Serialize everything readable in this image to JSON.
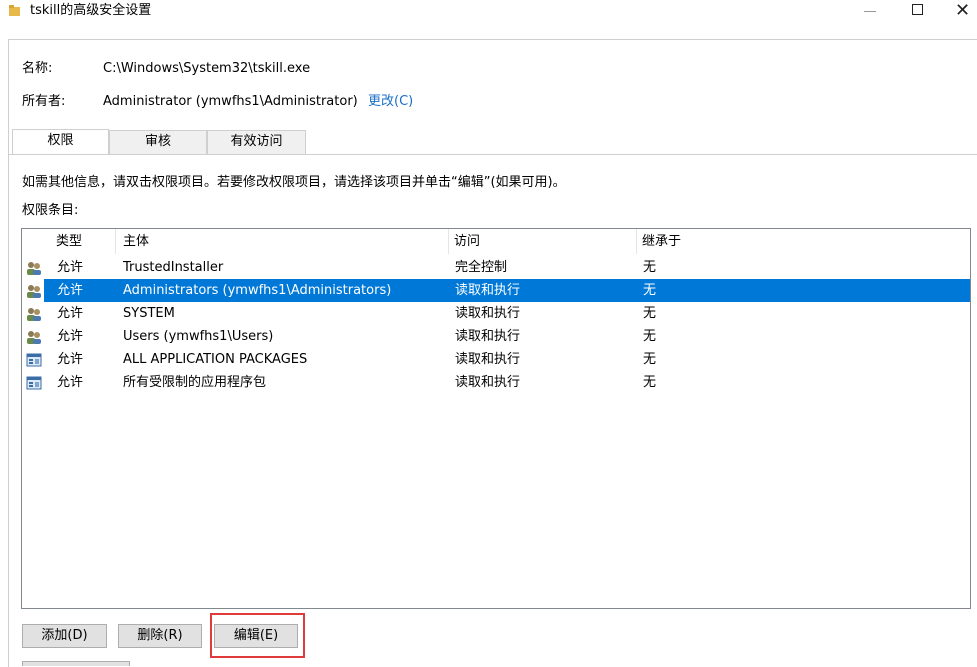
{
  "window": {
    "title": "tskill的高级安全设置"
  },
  "info": {
    "name_label": "名称:",
    "name_value": "C:\\Windows\\System32\\tskill.exe",
    "owner_label": "所有者:",
    "owner_value": "Administrator (ymwfhs1\\Administrator)",
    "change_link": "更改(C)"
  },
  "tabs": [
    {
      "label": "权限",
      "active": true
    },
    {
      "label": "审核",
      "active": false
    },
    {
      "label": "有效访问",
      "active": false
    }
  ],
  "instructions": "如需其他信息，请双击权限项目。若要修改权限项目，请选择该项目并单击“编辑”(如果可用)。",
  "entries_label": "权限条目:",
  "table": {
    "headers": [
      "类型",
      "主体",
      "访问",
      "继承于"
    ],
    "rows": [
      {
        "icon": "users-group-icon",
        "type": "允许",
        "principal": "TrustedInstaller",
        "access": "完全控制",
        "inherited": "无",
        "selected": false
      },
      {
        "icon": "users-group-icon",
        "type": "允许",
        "principal": "Administrators (ymwfhs1\\Administrators)",
        "access": "读取和执行",
        "inherited": "无",
        "selected": true
      },
      {
        "icon": "users-group-icon",
        "type": "允许",
        "principal": "SYSTEM",
        "access": "读取和执行",
        "inherited": "无",
        "selected": false
      },
      {
        "icon": "users-group-icon",
        "type": "允许",
        "principal": "Users (ymwfhs1\\Users)",
        "access": "读取和执行",
        "inherited": "无",
        "selected": false
      },
      {
        "icon": "app-package-icon",
        "type": "允许",
        "principal": "ALL APPLICATION PACKAGES",
        "access": "读取和执行",
        "inherited": "无",
        "selected": false
      },
      {
        "icon": "app-package-icon",
        "type": "允许",
        "principal": "所有受限制的应用程序包",
        "access": "读取和执行",
        "inherited": "无",
        "selected": false
      }
    ]
  },
  "buttons": {
    "add": "添加(D)",
    "remove": "删除(R)",
    "edit": "编辑(E)"
  },
  "colors": {
    "selection": "#0078d7",
    "link": "#1a6fc9",
    "highlight_border": "#e03b3b"
  }
}
